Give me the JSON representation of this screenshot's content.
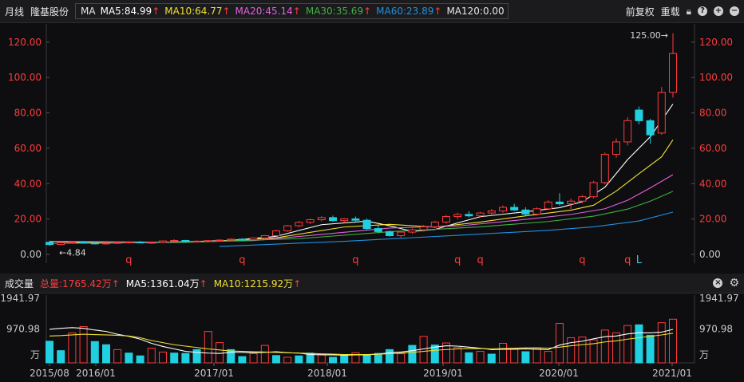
{
  "header": {
    "period": "月线",
    "stock_name": "隆基股份",
    "indicator": "MA",
    "ma5": "MA5:84.99",
    "ma10": "MA10:64.77",
    "ma20": "MA20:45.14",
    "ma30": "MA30:35.69",
    "ma60": "MA60:23.89",
    "ma120": "MA120:0.00",
    "adjust": "前复权",
    "overlay": "重载",
    "arrow": "↑"
  },
  "volume_header": {
    "title": "成交量",
    "total": "总量:1765.42万",
    "ma5": "MA5:1361.04万",
    "ma10": "MA10:1215.92万",
    "arrow": "↑"
  },
  "colors": {
    "up": "#ff3b3b",
    "down": "#20d0e0",
    "ma5": "#ffffff",
    "ma10": "#f0e030",
    "ma20": "#e060e0",
    "ma30": "#40b040",
    "ma60": "#2090e0",
    "grid": "#2a2a2e",
    "q_marker": "#ff3b3b",
    "l_marker": "#20d0e0"
  },
  "icons": {
    "lock": "lock-icon",
    "help": "help-icon",
    "zoom_in": "plus-icon",
    "zoom_out": "minus-icon",
    "close": "close-icon",
    "settings": "gear-icon"
  },
  "annotations": {
    "high": "125.00→",
    "low": "←4.84",
    "marker_q": "q",
    "marker_l": "L"
  },
  "chart_data": [
    {
      "type": "candlestick",
      "title": "",
      "ylim": [
        -3,
        128
      ],
      "y_ticks": [
        "0.00",
        "20.00",
        "40.00",
        "60.00",
        "80.00",
        "100.00",
        "120.00"
      ],
      "x_ticks": [
        "2015/08",
        "2016/01",
        "2017/01",
        "2018/01",
        "2019/01",
        "2020/01",
        "2021/01"
      ],
      "markers": [
        {
          "index": 7,
          "text": "q"
        },
        {
          "index": 17,
          "text": "q"
        },
        {
          "index": 27,
          "text": "q"
        },
        {
          "index": 36,
          "text": "q"
        },
        {
          "index": 38,
          "text": "q"
        },
        {
          "index": 47,
          "text": "q"
        },
        {
          "index": 51,
          "text": "q"
        },
        {
          "index": 52,
          "text": "L"
        }
      ],
      "ohlc": [
        [
          6.8,
          7.8,
          4.84,
          5.6
        ],
        [
          5.6,
          7.0,
          5.2,
          6.6
        ],
        [
          6.6,
          7.4,
          6.0,
          6.9
        ],
        [
          6.9,
          7.6,
          6.2,
          6.4
        ],
        [
          6.4,
          7.0,
          5.6,
          6.1
        ],
        [
          6.1,
          6.8,
          5.5,
          6.4
        ],
        [
          6.4,
          7.2,
          6.0,
          6.7
        ],
        [
          6.7,
          7.4,
          6.2,
          7.0
        ],
        [
          7.0,
          7.6,
          6.3,
          6.5
        ],
        [
          6.5,
          7.1,
          6.0,
          6.8
        ],
        [
          6.8,
          7.9,
          6.5,
          7.6
        ],
        [
          7.6,
          8.6,
          7.0,
          7.9
        ],
        [
          7.9,
          8.2,
          6.9,
          7.3
        ],
        [
          7.3,
          7.9,
          6.8,
          7.5
        ],
        [
          7.5,
          8.1,
          7.0,
          7.8
        ],
        [
          7.8,
          8.5,
          7.2,
          8.1
        ],
        [
          8.1,
          9.0,
          7.6,
          8.6
        ],
        [
          8.6,
          9.2,
          7.9,
          8.3
        ],
        [
          8.3,
          9.6,
          8.0,
          9.3
        ],
        [
          9.3,
          10.9,
          8.8,
          10.6
        ],
        [
          10.6,
          13.8,
          10.2,
          13.3
        ],
        [
          13.3,
          16.6,
          12.8,
          16.2
        ],
        [
          16.2,
          18.9,
          15.4,
          18.1
        ],
        [
          18.1,
          20.3,
          17.2,
          19.6
        ],
        [
          19.6,
          21.6,
          18.6,
          20.8
        ],
        [
          20.8,
          21.9,
          18.4,
          19.1
        ],
        [
          19.1,
          20.6,
          17.8,
          20.1
        ],
        [
          20.1,
          21.4,
          18.8,
          19.3
        ],
        [
          19.3,
          20.3,
          13.6,
          14.6
        ],
        [
          14.6,
          16.4,
          12.1,
          12.9
        ],
        [
          12.9,
          13.5,
          10.1,
          10.6
        ],
        [
          10.6,
          13.2,
          9.6,
          12.6
        ],
        [
          12.6,
          14.8,
          11.6,
          13.9
        ],
        [
          13.9,
          16.6,
          13.0,
          15.6
        ],
        [
          15.6,
          19.0,
          14.8,
          18.3
        ],
        [
          18.3,
          22.2,
          17.4,
          21.4
        ],
        [
          21.4,
          23.6,
          19.8,
          22.6
        ],
        [
          22.6,
          24.4,
          21.0,
          21.8
        ],
        [
          21.8,
          24.1,
          20.8,
          23.4
        ],
        [
          23.4,
          25.6,
          22.0,
          24.6
        ],
        [
          24.6,
          27.6,
          23.6,
          26.6
        ],
        [
          26.6,
          28.6,
          24.6,
          25.1
        ],
        [
          25.1,
          26.6,
          22.1,
          22.8
        ],
        [
          22.8,
          26.6,
          22.0,
          25.8
        ],
        [
          25.8,
          30.6,
          25.0,
          29.6
        ],
        [
          29.6,
          34.6,
          27.6,
          28.6
        ],
        [
          28.6,
          31.6,
          25.6,
          30.1
        ],
        [
          30.1,
          33.6,
          29.0,
          32.6
        ],
        [
          32.6,
          41.6,
          31.6,
          40.6
        ],
        [
          40.6,
          57.6,
          39.6,
          56.6
        ],
        [
          56.6,
          65.6,
          54.6,
          63.6
        ],
        [
          63.6,
          77.6,
          61.6,
          75.6
        ],
        [
          81.6,
          83.6,
          73.6,
          75.6
        ],
        [
          75.6,
          76.6,
          62.6,
          67.6
        ],
        [
          68.6,
          94.6,
          67.6,
          91.6
        ],
        [
          91.6,
          125.0,
          88.6,
          113.6
        ]
      ],
      "ma": {
        "ma5": [
          [
            0,
            7.4
          ],
          [
            4,
            6.4
          ],
          [
            10,
            6.8
          ],
          [
            16,
            7.9
          ],
          [
            20,
            10.2
          ],
          [
            24,
            16.8
          ],
          [
            28,
            18.8
          ],
          [
            30,
            16.2
          ],
          [
            32,
            13.0
          ],
          [
            34,
            14.1
          ],
          [
            36,
            17.8
          ],
          [
            38,
            21.3
          ],
          [
            42,
            24.1
          ],
          [
            45,
            26.4
          ],
          [
            47,
            29.8
          ],
          [
            49,
            38.0
          ],
          [
            51,
            53.6
          ],
          [
            53,
            66.5
          ],
          [
            55,
            85.0
          ]
        ],
        "ma10": [
          [
            0,
            7.3
          ],
          [
            6,
            6.6
          ],
          [
            14,
            7.2
          ],
          [
            20,
            9.4
          ],
          [
            26,
            15.5
          ],
          [
            30,
            17.0
          ],
          [
            34,
            15.4
          ],
          [
            38,
            18.3
          ],
          [
            42,
            21.8
          ],
          [
            46,
            25.0
          ],
          [
            48,
            27.8
          ],
          [
            50,
            35.8
          ],
          [
            52,
            45.6
          ],
          [
            54,
            55.2
          ],
          [
            55,
            64.8
          ]
        ],
        "ma20": [
          [
            0,
            7.4
          ],
          [
            10,
            6.9
          ],
          [
            18,
            7.8
          ],
          [
            24,
            11.3
          ],
          [
            30,
            14.9
          ],
          [
            36,
            16.0
          ],
          [
            42,
            19.8
          ],
          [
            46,
            22.6
          ],
          [
            49,
            25.8
          ],
          [
            51,
            30.6
          ],
          [
            53,
            37.6
          ],
          [
            55,
            45.1
          ]
        ],
        "ma30": [
          [
            0,
            6.2
          ],
          [
            12,
            6.8
          ],
          [
            22,
            8.9
          ],
          [
            30,
            12.8
          ],
          [
            38,
            15.6
          ],
          [
            44,
            18.6
          ],
          [
            48,
            21.6
          ],
          [
            51,
            25.6
          ],
          [
            53,
            30.1
          ],
          [
            55,
            35.7
          ]
        ],
        "ma60": [
          [
            15,
            4.5
          ],
          [
            26,
            7.4
          ],
          [
            36,
            10.8
          ],
          [
            44,
            13.6
          ],
          [
            48,
            15.6
          ],
          [
            52,
            18.9
          ],
          [
            55,
            23.9
          ]
        ]
      }
    },
    {
      "type": "bar",
      "title": "",
      "ylim": [
        0,
        1941.97
      ],
      "y_ticks": [
        "1941.97",
        "970.98",
        "万"
      ],
      "values": [
        620,
        350,
        860,
        1040,
        610,
        520,
        380,
        280,
        200,
        420,
        310,
        280,
        270,
        380,
        900,
        580,
        380,
        180,
        270,
        500,
        210,
        160,
        200,
        280,
        250,
        160,
        210,
        290,
        230,
        270,
        380,
        260,
        500,
        760,
        510,
        570,
        440,
        290,
        330,
        250,
        560,
        410,
        320,
        430,
        330,
        1130,
        720,
        740,
        660,
        940,
        860,
        1070,
        1090,
        790,
        1150,
        1250
      ],
      "up_index": [
        2,
        3,
        6,
        9,
        10,
        14,
        15,
        18,
        19,
        21,
        24,
        27,
        31,
        33,
        35,
        36,
        38,
        40,
        41,
        43,
        44,
        45,
        46,
        47,
        48,
        49,
        50,
        51,
        54,
        55
      ],
      "ma5": [
        960,
        990,
        1010,
        990,
        940,
        900,
        820,
        760,
        680,
        560,
        470,
        400,
        330,
        300,
        280,
        270,
        300,
        300,
        290,
        300,
        320,
        290,
        280,
        240,
        230,
        230,
        220,
        230,
        230,
        250,
        290,
        310,
        350,
        400,
        450,
        490,
        480,
        450,
        420,
        380,
        390,
        390,
        400,
        390,
        380,
        510,
        580,
        620,
        690,
        750,
        770,
        830,
        860,
        860,
        880,
        960
      ],
      "ma10": [
        770,
        780,
        800,
        820,
        810,
        800,
        790,
        770,
        720,
        640,
        580,
        520,
        480,
        440,
        400,
        370,
        340,
        330,
        320,
        310,
        300,
        290,
        280,
        270,
        260,
        250,
        240,
        240,
        240,
        250,
        260,
        280,
        300,
        330,
        360,
        380,
        400,
        410,
        410,
        400,
        410,
        420,
        430,
        430,
        420,
        450,
        490,
        520,
        550,
        600,
        630,
        680,
        720,
        760,
        800,
        850
      ]
    }
  ]
}
